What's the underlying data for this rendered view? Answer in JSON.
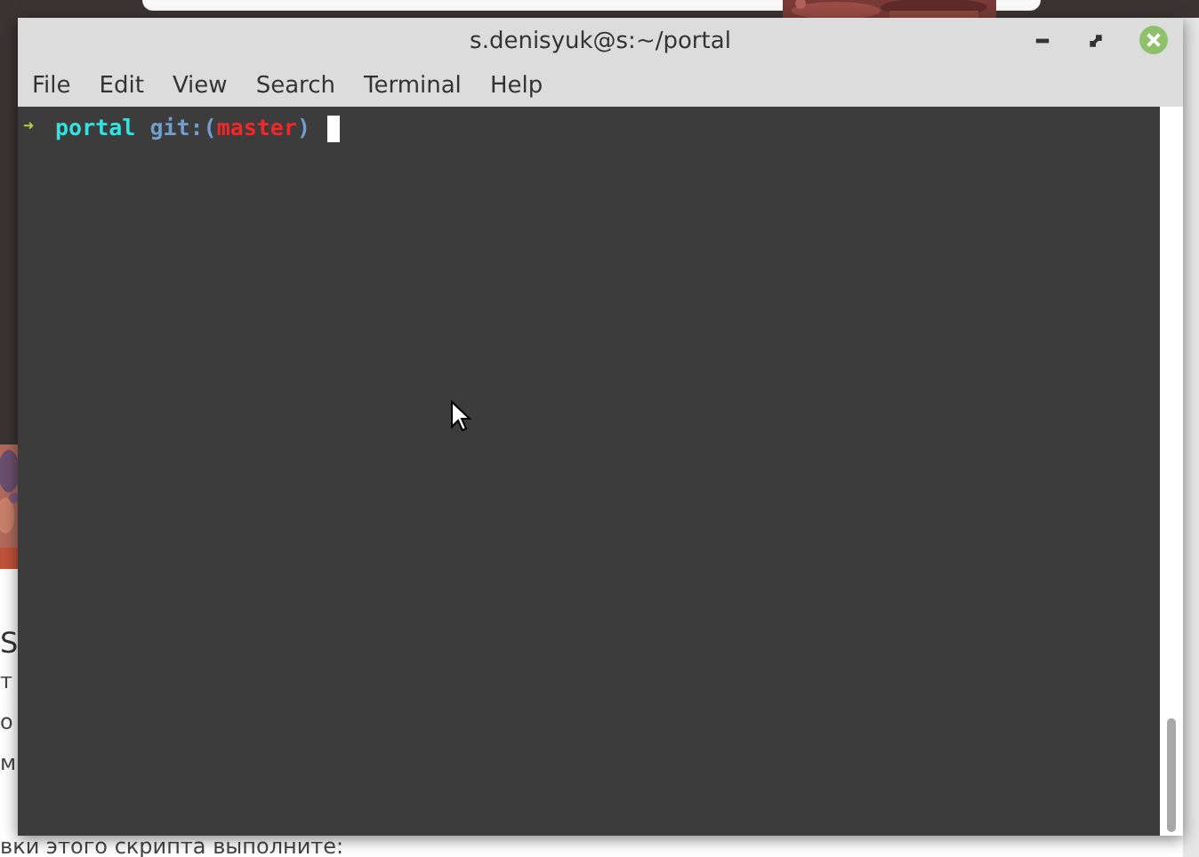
{
  "background_page": {
    "heading": "S",
    "lines": [
      "т",
      "о",
      "м",
      "вки этого скрипта выполните:"
    ]
  },
  "window": {
    "title": "s.denisyuk@s:~/portal"
  },
  "menu": [
    "File",
    "Edit",
    "View",
    "Search",
    "Terminal",
    "Help"
  ],
  "terminal": {
    "prompt_arrow": "➜",
    "directory": "portal",
    "git_label": "git:(",
    "branch": "master",
    "git_close": ")"
  }
}
